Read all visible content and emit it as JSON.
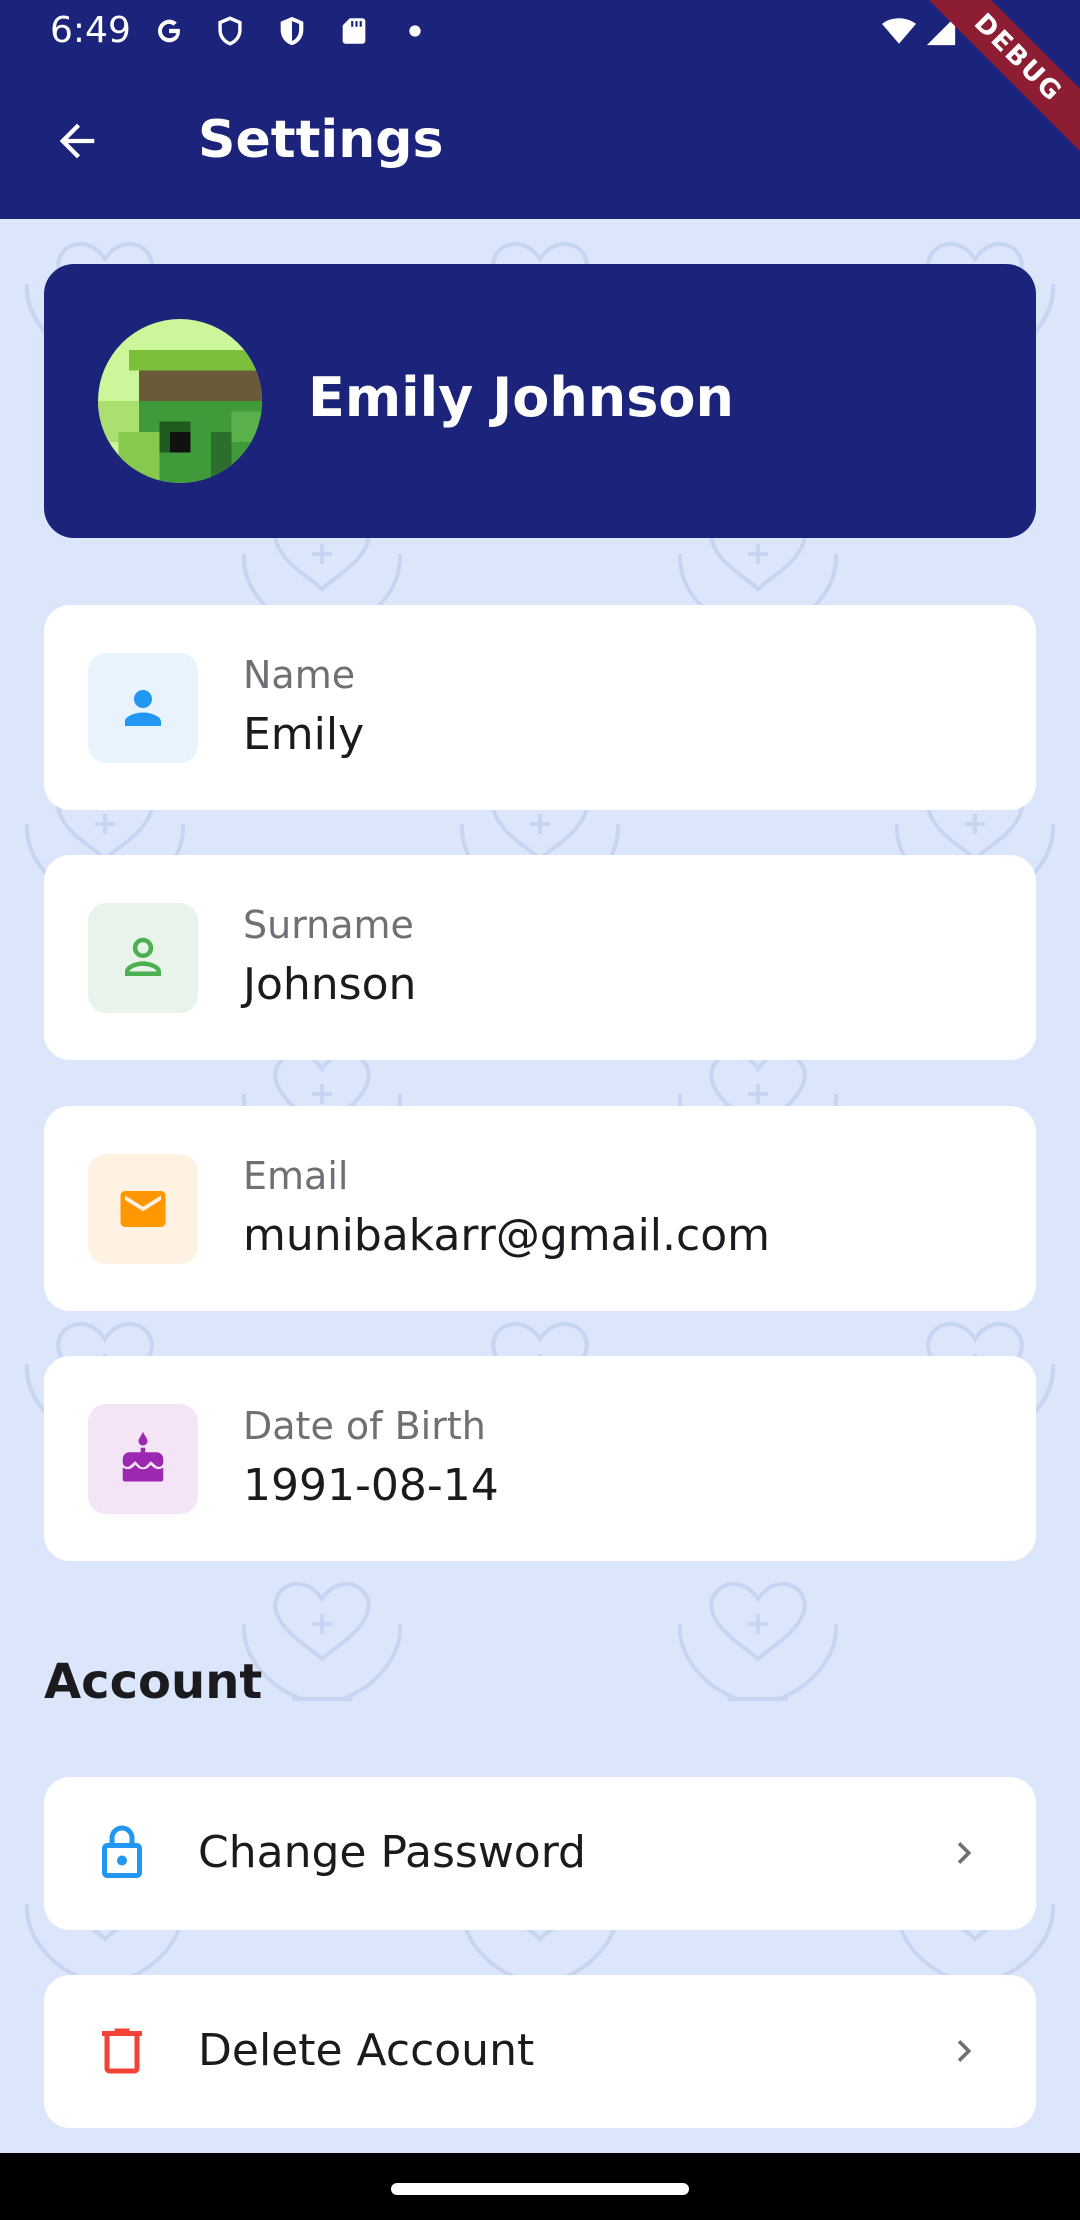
{
  "status_bar": {
    "time": "6:49",
    "icons": [
      "google-icon",
      "shield-outline-icon",
      "shield-filled-icon",
      "sd-card-icon",
      "dot-icon",
      "wifi-icon",
      "signal-icon",
      "battery-icon"
    ]
  },
  "app_bar": {
    "title": "Settings",
    "back_icon": "arrow-back-icon"
  },
  "debug_banner": "DEBUG",
  "profile": {
    "full_name": "Emily Johnson"
  },
  "fields": [
    {
      "label": "Name",
      "value": "Emily",
      "icon": "person-icon",
      "icon_color": "#2196f3",
      "icon_bg": "#e9f3fd"
    },
    {
      "label": "Surname",
      "value": "Johnson",
      "icon": "person-outline-icon",
      "icon_color": "#4caf50",
      "icon_bg": "#e8f4ea"
    },
    {
      "label": "Email",
      "value": "munibakarr@gmail.com",
      "icon": "email-icon",
      "icon_color": "#ff9800",
      "icon_bg": "#fff2e3"
    },
    {
      "label": "Date of Birth",
      "value": "1991-08-14",
      "icon": "cake-icon",
      "icon_color": "#9c27b0",
      "icon_bg": "#f3e4f6"
    }
  ],
  "account": {
    "title": "Account",
    "items": [
      {
        "label": "Change Password",
        "icon": "lock-icon",
        "icon_color": "#2196f3"
      },
      {
        "label": "Delete Account",
        "icon": "trash-icon",
        "icon_color": "#f44336"
      }
    ]
  },
  "colors": {
    "primary": "#1b237a",
    "background": "#dbe6fb",
    "card": "#ffffff"
  }
}
